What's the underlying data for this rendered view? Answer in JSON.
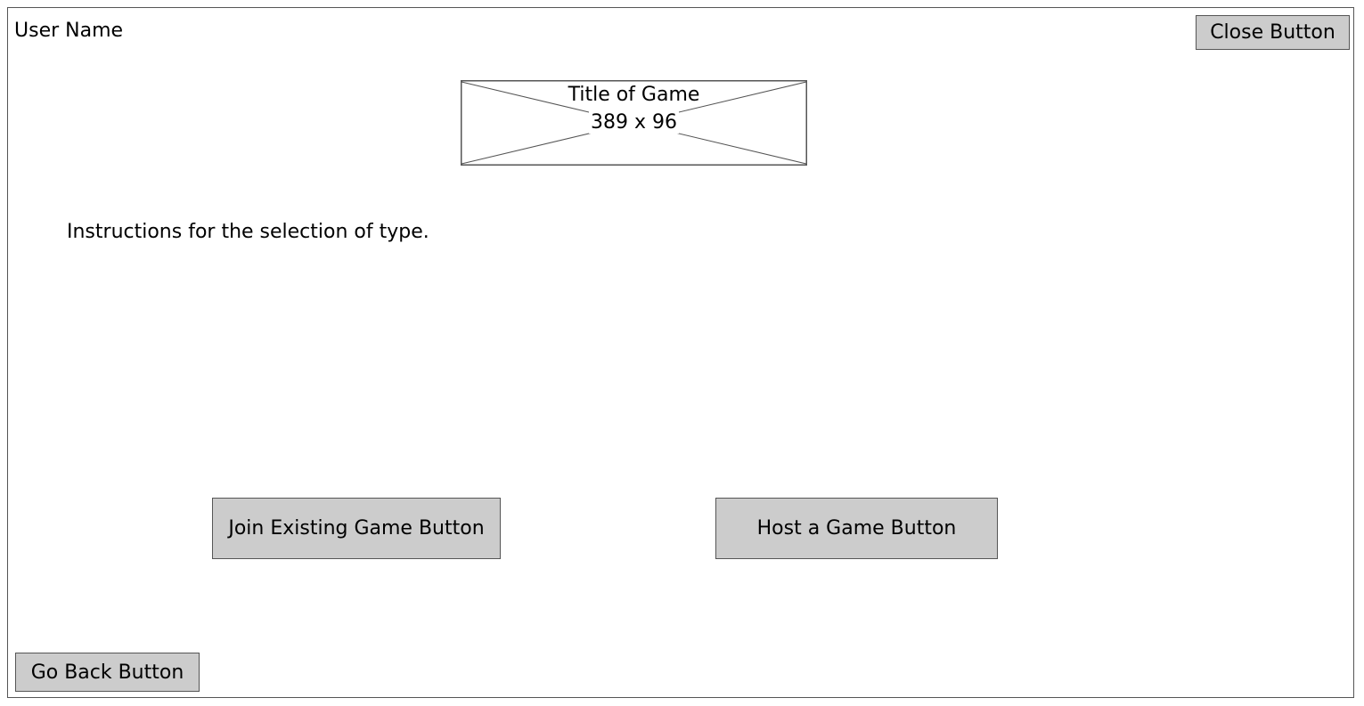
{
  "header": {
    "user_name": "User Name",
    "close_label": "Close Button"
  },
  "title_image": {
    "label": "Title of Game",
    "dimensions": "389 x 96"
  },
  "main": {
    "instructions": "Instructions for the selection of type.",
    "join_label": "Join Existing Game Button",
    "host_label": "Host a Game Button"
  },
  "footer": {
    "back_label": "Go Back Button"
  },
  "colors": {
    "button_fill": "#cccccc",
    "border": "#555555",
    "background": "#ffffff"
  }
}
